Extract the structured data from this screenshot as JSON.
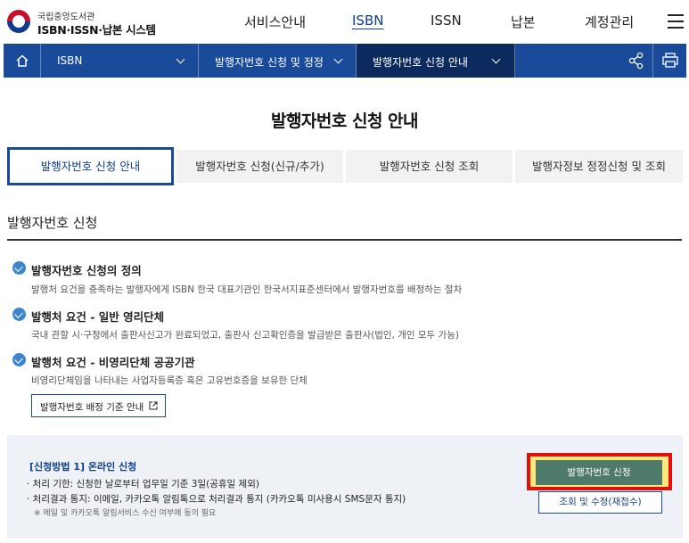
{
  "header": {
    "logo_org": "국립중앙도서관",
    "logo_system": "ISBN·ISSN·납본 시스템",
    "nav": [
      "서비스안내",
      "ISBN",
      "ISSN",
      "납본",
      "계정관리"
    ]
  },
  "breadcrumb": {
    "items": [
      "ISBN",
      "발행자번호 신청 및 정정",
      "발행자번호 신청 안내"
    ]
  },
  "page_title": "발행자번호 신청 안내",
  "tabs": [
    "발행자번호 신청 안내",
    "발행자번호 신청(신규/추가)",
    "발행자번호 신청 조회",
    "발행자정보 정정신청 및 조회"
  ],
  "section": {
    "title": "발행자번호 신청",
    "items": [
      {
        "title": "발행자번호 신청의 정의",
        "desc": "발행처 요건을 충족하는 발행자에게 ISBN 한국 대표기관인 한국서지표준센터에서 발행자번호를 배정하는 절차"
      },
      {
        "title": "발행처 요건 - 일반 영리단체",
        "desc": "국내 관할 시·구청에서 출판사신고가 완료되었고, 출판사 신고확인증을 발급받은 출판사(법인, 개인 모두 가능)"
      },
      {
        "title": "발행처 요건 - 비영리단체 공공기관",
        "desc": "비영리단체임을 나타내는 사업자등록증 혹은 고유번호증을 보유한 단체"
      }
    ],
    "guide_button": "발행자번호 배정 기준 안내"
  },
  "panel": {
    "title": "[신청방법 1] 온라인 신청",
    "line1": "· 처리 기한: 신청한 날로부터 업무일 기준 3일(공휴일 제외)",
    "line2": "· 처리결과 통지: 이메일, 카카오톡 알림톡으로 처리결과 통지 (카카오톡 미사용시 SMS문자 통지)",
    "note": "※ 메일 및 카카오톡 알림서비스 수신 여부에 동의 필요",
    "apply_button": "발행자번호 신청",
    "modify_button": "조회 및 수정(재접수)"
  }
}
